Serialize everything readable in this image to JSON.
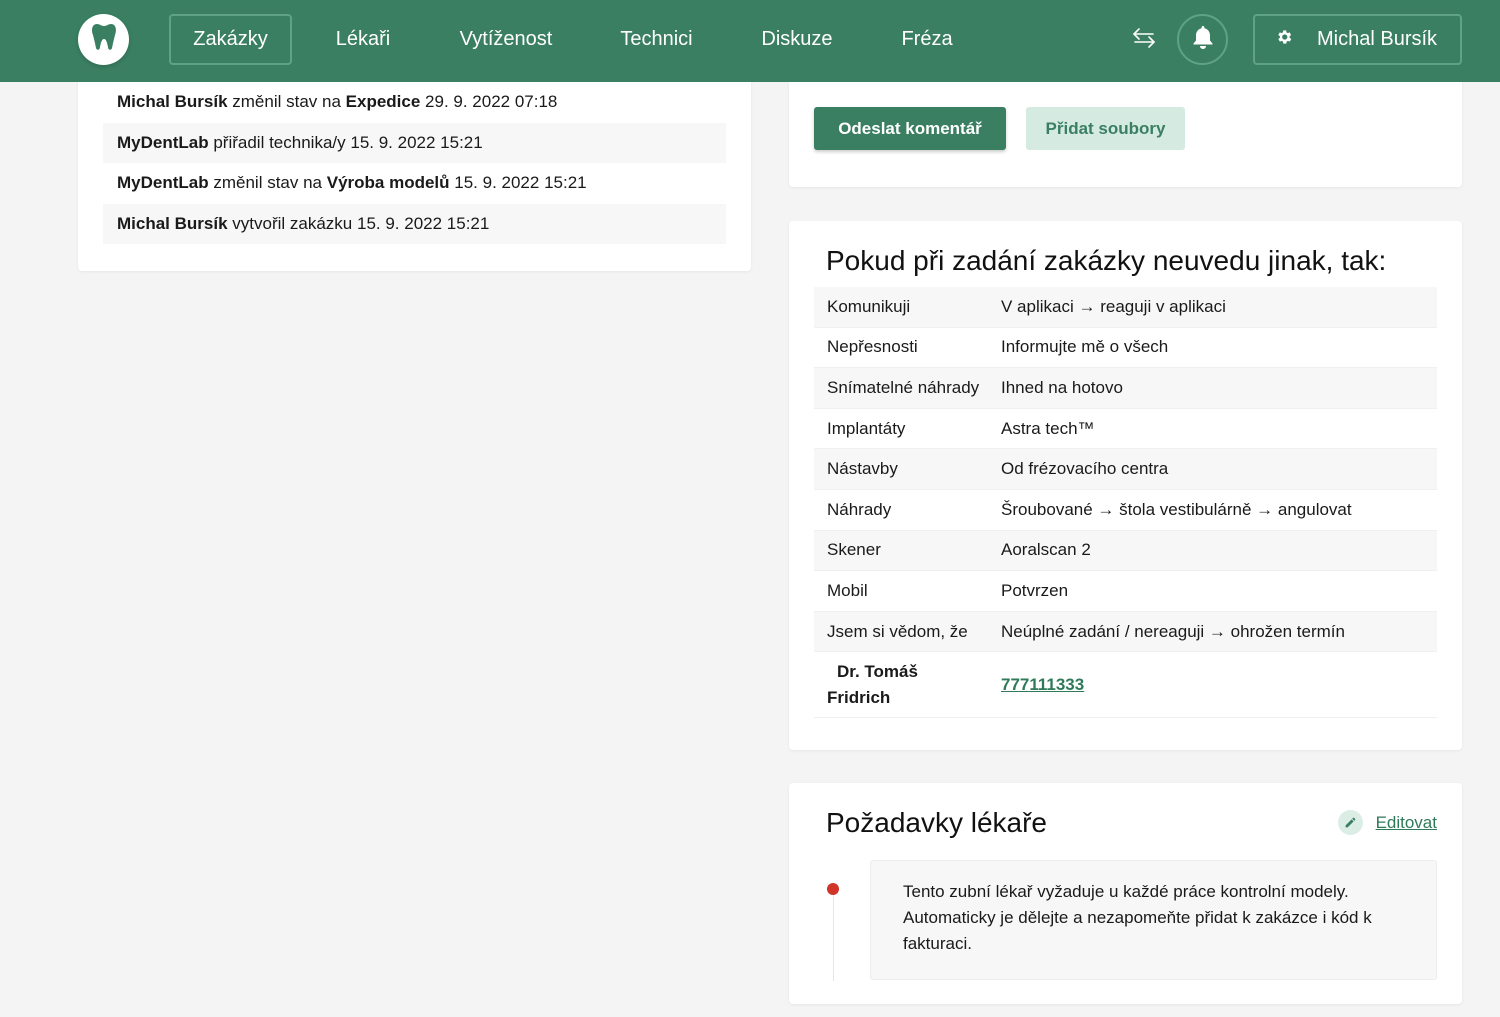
{
  "nav": {
    "items": [
      {
        "label": "Zakázky",
        "active": true
      },
      {
        "label": "Lékaři"
      },
      {
        "label": "Vytíženost"
      },
      {
        "label": "Technici"
      },
      {
        "label": "Diskuze"
      },
      {
        "label": "Fréza"
      }
    ],
    "user_name": "Michal Bursík",
    "icons": [
      "tooth-icon",
      "swap-icon",
      "bell-icon",
      "gear-icon"
    ],
    "colors": {
      "primary": "#3a7f62",
      "accent_light": "#d5ebe2",
      "status_dot": "#d0352a"
    }
  },
  "history": [
    {
      "actor": "Michal Bursík",
      "action": " změnil stav na ",
      "target": "Expedice",
      "time": " 29. 9. 2022 07:18"
    },
    {
      "actor": "MyDentLab",
      "action": " přiřadil technika/y ",
      "target": "",
      "time": "15. 9. 2022 15:21"
    },
    {
      "actor": "MyDentLab",
      "action": " změnil stav na ",
      "target": "Výroba modelů",
      "time": " 15. 9. 2022 15:21"
    },
    {
      "actor": "Michal Bursík",
      "action": " vytvořil zakázku ",
      "target": "",
      "time": "15. 9. 2022 15:21"
    }
  ],
  "comment": {
    "send_label": "Odeslat komentář",
    "files_label": "Přidat soubory"
  },
  "prefs": {
    "title": "Pokud při zadání zakázky neuvedu jinak, tak:",
    "rows": [
      {
        "key": "Komunikuji",
        "value": "V aplikaci → reaguji v aplikaci"
      },
      {
        "key": "Nepřesnosti",
        "value": "Informujte mě o všech"
      },
      {
        "key": "Snímatelné náhrady",
        "value": "Ihned na hotovo"
      },
      {
        "key": "Implantáty",
        "value": "Astra tech™"
      },
      {
        "key": "Nástavby",
        "value": "Od frézovacího centra"
      },
      {
        "key": "Náhrady",
        "value": "Šroubované → štola vestibulárně → angulovat"
      },
      {
        "key": "Skener",
        "value": "Aoralscan 2"
      },
      {
        "key": "Mobil",
        "value": "Potvrzen"
      },
      {
        "key": "Jsem si vědom, že",
        "value": "Neúplné zadání / nereaguji → ohrožen termín"
      }
    ],
    "doctor_line1": "Dr. Tomáš",
    "doctor_line2": "Fridrich",
    "doctor_phone": "777111333"
  },
  "requirements": {
    "title": "Požadavky lékaře",
    "edit_label": "Editovat",
    "note": "Tento zubní lékař vyžaduje u každé práce kontrolní modely. Automaticky je dělejte a nezapomeňte přidat k zakázce i kód k fakturaci."
  }
}
